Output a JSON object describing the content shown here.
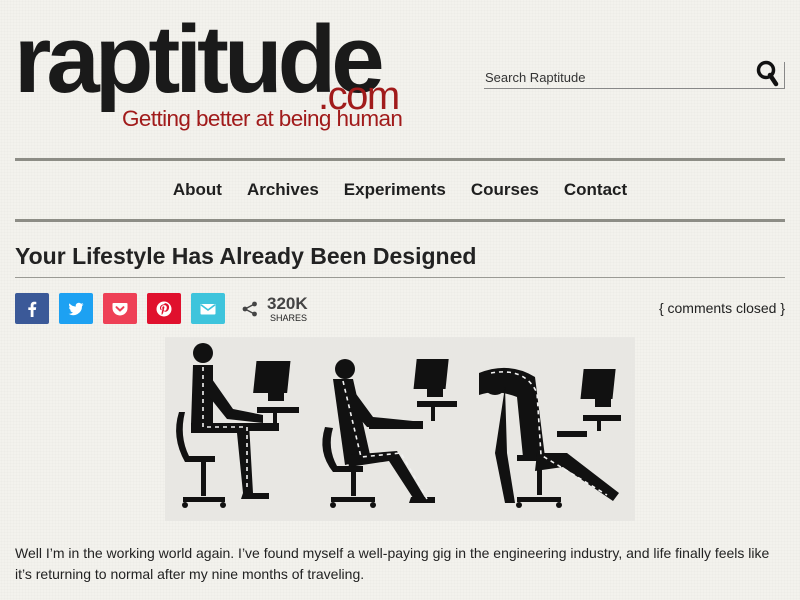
{
  "site": {
    "logo_main": "raptitude",
    "logo_domain": ".com",
    "tagline": "Getting better at being human"
  },
  "search": {
    "placeholder": "Search Raptitude",
    "button_icon": "search-icon"
  },
  "nav": {
    "items": [
      {
        "label": "About"
      },
      {
        "label": "Archives"
      },
      {
        "label": "Experiments"
      },
      {
        "label": "Courses"
      },
      {
        "label": "Contact"
      }
    ]
  },
  "post": {
    "title": "Your Lifestyle Has Already Been Designed",
    "comments": "{ comments closed }",
    "body": "Well I’m in the working world again. I’ve found myself a well-paying gig in the engineering industry, and life finally feels like it’s returning to normal after my nine months of traveling."
  },
  "share": {
    "buttons": [
      {
        "network": "facebook",
        "letter": "K",
        "icon": "facebook-icon",
        "color": "#3b5998"
      },
      {
        "network": "twitter",
        "letter": "T",
        "icon": "twitter-icon",
        "color": "#1da1f2"
      },
      {
        "network": "pocket",
        "letter": "P",
        "icon": "pocket-icon",
        "color": "#ee4056"
      },
      {
        "network": "pinterest",
        "letter": "A",
        "icon": "pinterest-icon",
        "color": "#e0102d"
      },
      {
        "network": "email",
        "letter": "I",
        "icon": "email-icon",
        "color": "#3ec4dc"
      }
    ],
    "total_icon": "share-icon",
    "total_count": "320K",
    "total_label": "SHARES"
  },
  "colors": {
    "brand_red": "#a11b1b",
    "background": "#f3f2ed"
  }
}
